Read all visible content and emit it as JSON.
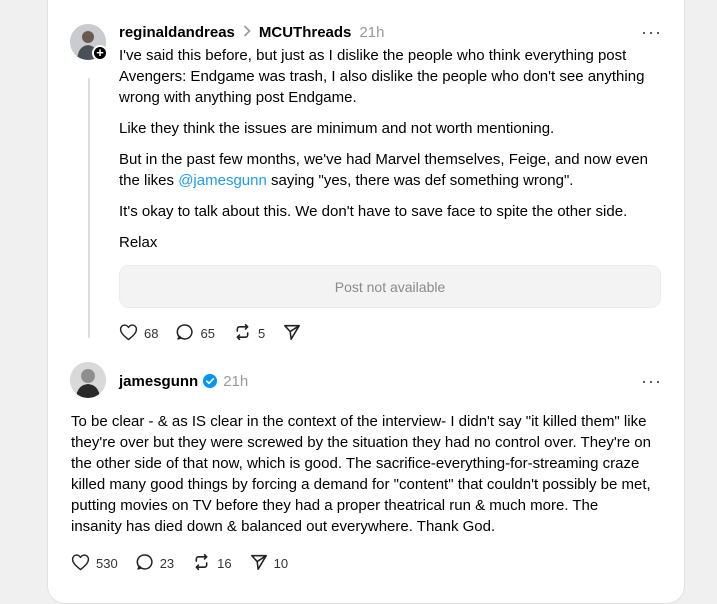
{
  "post1": {
    "username": "reginaldandreas",
    "community": "MCUThreads",
    "time": "21h",
    "paragraphs": [
      "I've said this before, but just as I dislike the people who think everything post Avengers: Endgame was trash, I also dislike the people who don't see anything wrong with anything post Endgame.",
      "Like they think the issues are minimum and not worth mentioning.",
      "But in the past few months, we've had Marvel themselves, Feige, and now even the likes ",
      "It's okay to talk about this. We don't have to save face to spite the other side.",
      "Relax"
    ],
    "mention": "@jamesgunn",
    "p3_tail": " saying \"yes, there was def something wrong\".",
    "quoted_post": "Post not available",
    "likes": "68",
    "replies": "65",
    "reposts": "5"
  },
  "post2": {
    "username": "jamesgunn",
    "time": "21h",
    "text": "To be clear - & as IS clear in the context of the interview- I didn't say \"it killed them\" like they're over but they were screwed by the situation they had no control over. They're on the other side of that now, which is good. The sacrifice-everything-for-streaming craze killed many good things by forcing a demand for \"content\" that couldn't possibly be met, putting movies on TV before they had a proper theatrical run & much more. The insanity has died down & balanced out everywhere. Thank God.",
    "likes": "530",
    "replies": "23",
    "reposts": "16",
    "shares": "10"
  },
  "icons": {
    "like": "heart-icon",
    "reply": "comment-bubble-icon",
    "repost": "repost-icon",
    "share": "send-icon",
    "more": "more-dots-icon",
    "verified": "verified-badge-icon",
    "follow": "plus-icon",
    "chevron": "chevron-right-icon"
  },
  "colors": {
    "mention": "#1d9bf0",
    "verified": "#0095f6",
    "muted": "#999999"
  }
}
